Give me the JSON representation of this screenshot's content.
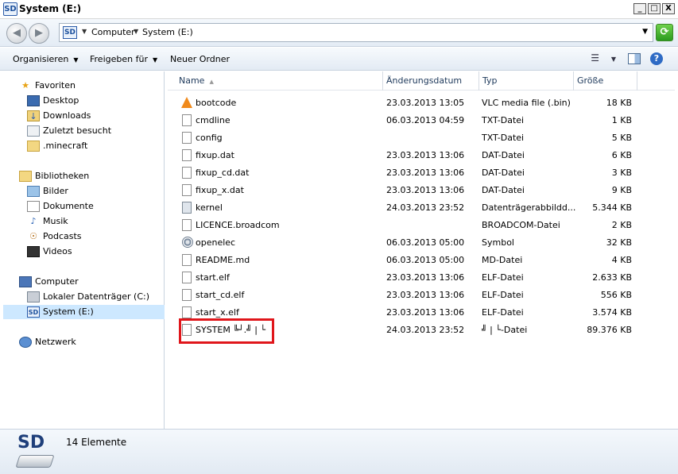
{
  "window": {
    "title": "System (E:)",
    "icon_text": "SD"
  },
  "window_controls": {
    "minimize": "_",
    "maximize": "□",
    "close": "X"
  },
  "address": {
    "icon_text": "SD",
    "crumbs": [
      "Computer",
      "System (E:)"
    ]
  },
  "toolbar": {
    "organize": "Organisieren",
    "share": "Freigeben für",
    "new_folder": "Neuer Ordner",
    "help": "?"
  },
  "nav": {
    "favorites": "Favoriten",
    "favorites_items": [
      "Desktop",
      "Downloads",
      "Zuletzt besucht",
      ".minecraft"
    ],
    "libraries": "Bibliotheken",
    "libraries_items": [
      "Bilder",
      "Dokumente",
      "Musik",
      "Podcasts",
      "Videos"
    ],
    "computer": "Computer",
    "computer_items": [
      "Lokaler Datenträger (C:)",
      "System (E:)"
    ],
    "network": "Netzwerk"
  },
  "columns": {
    "name": "Name",
    "date": "Änderungsdatum",
    "type": "Typ",
    "size": "Größe"
  },
  "files": [
    {
      "name": "bootcode",
      "date": "23.03.2013 13:05",
      "type": "VLC media file (.bin)",
      "size": "18 KB",
      "icon": "vlc-icon"
    },
    {
      "name": "cmdline",
      "date": "06.03.2013 04:59",
      "type": "TXT-Datei",
      "size": "1 KB",
      "icon": "text-file-icon"
    },
    {
      "name": "config",
      "date": "",
      "type": "TXT-Datei",
      "size": "5 KB",
      "icon": "text-file-icon"
    },
    {
      "name": "fixup.dat",
      "date": "23.03.2013 13:06",
      "type": "DAT-Datei",
      "size": "6 KB",
      "icon": "file-icon"
    },
    {
      "name": "fixup_cd.dat",
      "date": "23.03.2013 13:06",
      "type": "DAT-Datei",
      "size": "3 KB",
      "icon": "file-icon"
    },
    {
      "name": "fixup_x.dat",
      "date": "23.03.2013 13:06",
      "type": "DAT-Datei",
      "size": "9 KB",
      "icon": "file-icon"
    },
    {
      "name": "kernel",
      "date": "24.03.2013 23:52",
      "type": "Datenträgerabbildd...",
      "size": "5.344 KB",
      "icon": "disk-image-icon"
    },
    {
      "name": "LICENCE.broadcom",
      "date": "",
      "type": "BROADCOM-Datei",
      "size": "2 KB",
      "icon": "file-icon"
    },
    {
      "name": "openelec",
      "date": "06.03.2013 05:00",
      "type": "Symbol",
      "size": "32 KB",
      "icon": "gear-icon"
    },
    {
      "name": "README.md",
      "date": "06.03.2013 05:00",
      "type": "MD-Datei",
      "size": "4 KB",
      "icon": "file-icon"
    },
    {
      "name": "start.elf",
      "date": "23.03.2013 13:06",
      "type": "ELF-Datei",
      "size": "2.633 KB",
      "icon": "file-icon"
    },
    {
      "name": "start_cd.elf",
      "date": "23.03.2013 13:06",
      "type": "ELF-Datei",
      "size": "556 KB",
      "icon": "file-icon"
    },
    {
      "name": "start_x.elf",
      "date": "23.03.2013 13:06",
      "type": "ELF-Datei",
      "size": "3.574 KB",
      "icon": "file-icon"
    },
    {
      "name": "SYSTEM ╚┘.╝ | └",
      "date": "24.03.2013 23:52",
      "type": "╝ | └-Datei",
      "size": "89.376 KB",
      "icon": "file-icon"
    }
  ],
  "details": {
    "icon_text": "SD",
    "count": "14 Elemente"
  },
  "colors": {
    "selection": "#cde8ff",
    "highlight_box": "#e0161b"
  }
}
